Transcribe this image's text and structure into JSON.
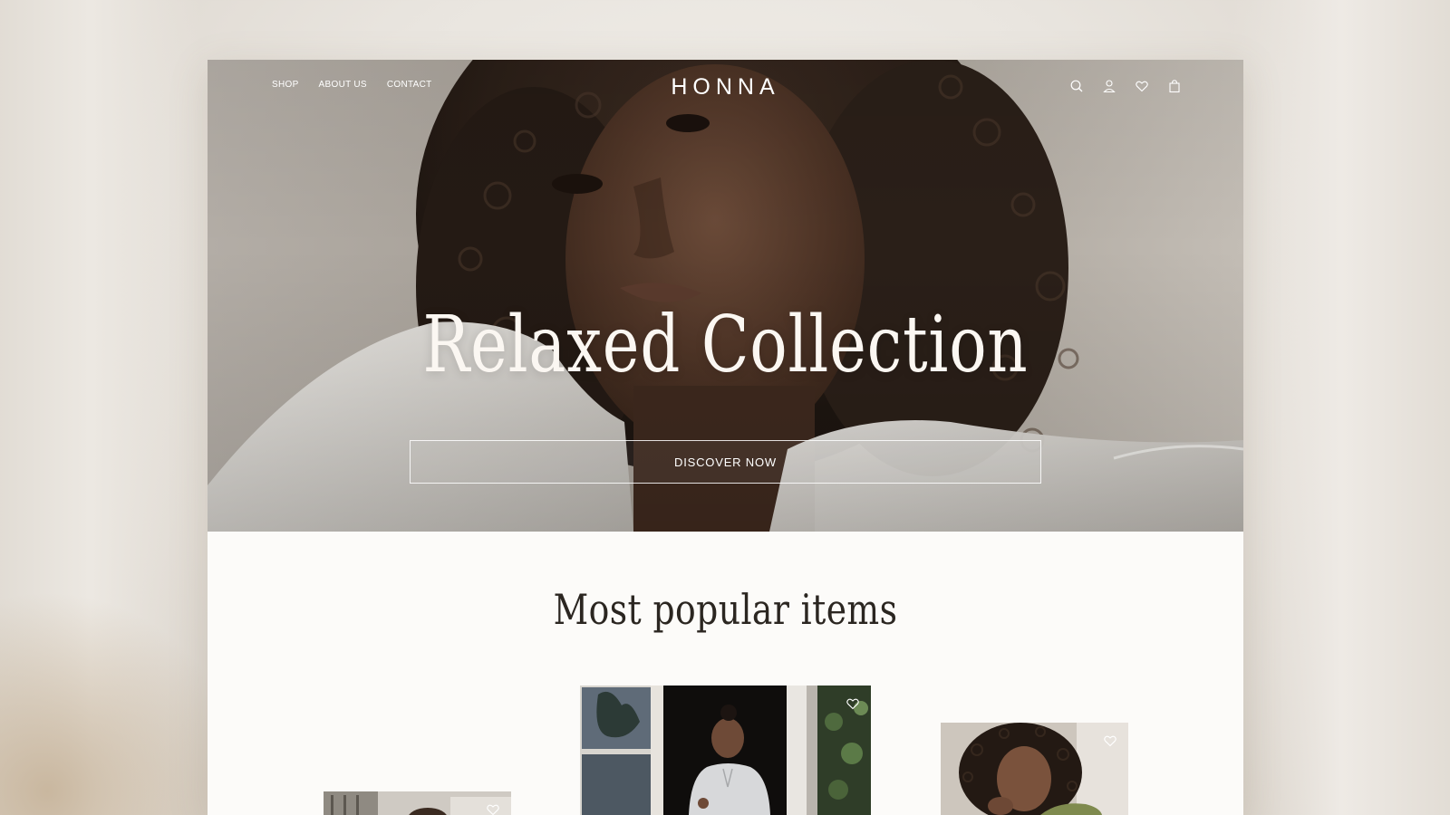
{
  "brand": {
    "name": "HONNA"
  },
  "nav": {
    "items": [
      {
        "label": "SHOP"
      },
      {
        "label": "ABOUT US"
      },
      {
        "label": "CONTACT"
      }
    ]
  },
  "header_icons": [
    "search-icon",
    "user-icon",
    "heart-icon",
    "bag-icon"
  ],
  "hero": {
    "title": "Relaxed Collection",
    "cta_label": "DISCOVER NOW"
  },
  "popular": {
    "title": "Most popular items",
    "products": [
      {
        "image": "product-photo-1",
        "icon": "heart-icon"
      },
      {
        "image": "product-photo-2",
        "icon": "heart-icon"
      },
      {
        "image": "product-photo-3",
        "icon": "heart-icon"
      }
    ]
  },
  "colors": {
    "hero_text": "#fbf7f2",
    "page_bg": "#fcfbf9",
    "heading_text": "#2b2621"
  }
}
